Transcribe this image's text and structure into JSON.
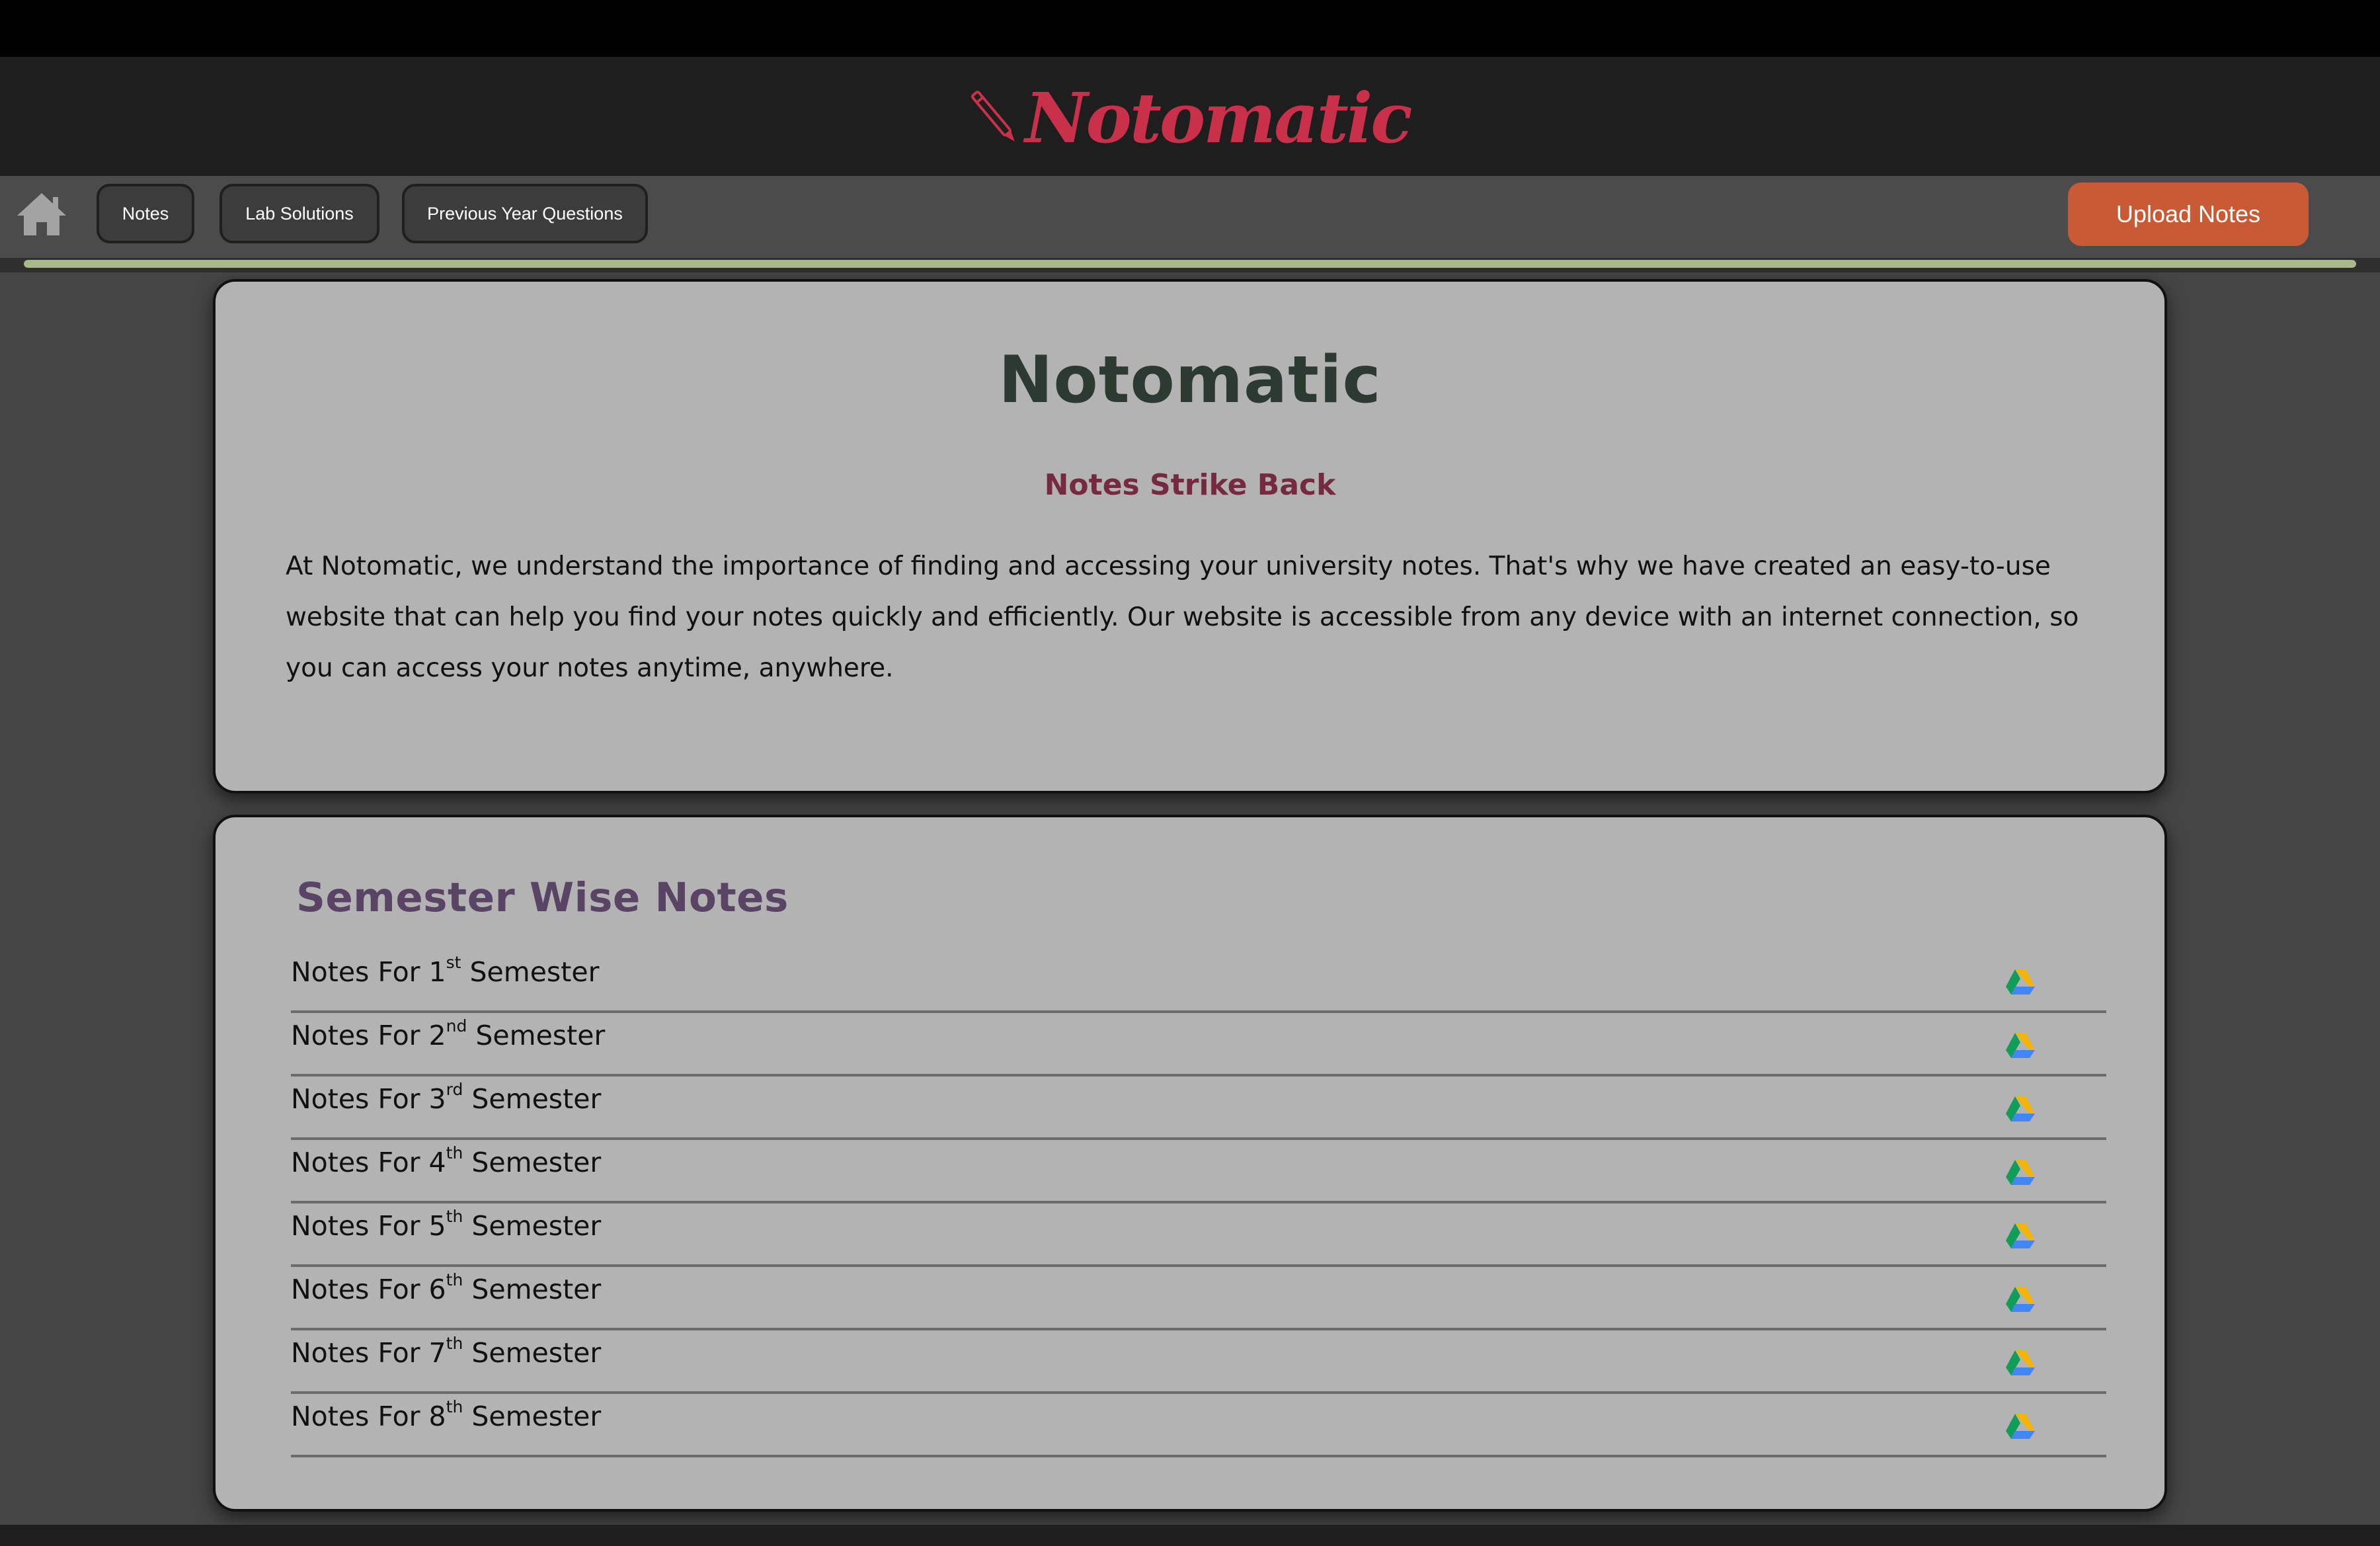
{
  "brand": {
    "logo_text": "Notomatic",
    "logo_color": "#c9314a"
  },
  "nav": {
    "home_icon": "home-icon",
    "items": [
      {
        "label": "Notes"
      },
      {
        "label": "Lab Solutions"
      },
      {
        "label": "Previous Year Questions"
      }
    ],
    "upload_label": "Upload Notes",
    "accent_color": "#c95a36"
  },
  "progress": {
    "fill_percent": 100,
    "color": "#a9b98a"
  },
  "hero": {
    "title": "Notomatic",
    "subtitle": "Notes Strike Back",
    "description": "At Notomatic, we understand the importance of finding and accessing your university notes. That's why we have created an easy-to-use website that can help you find your notes quickly and efficiently. Our website is accessible from any device with an internet connection, so you can access your notes anytime, anywhere."
  },
  "semesters": {
    "title": "Semester Wise Notes",
    "link_icon": "google-drive-icon",
    "items": [
      {
        "prefix": "Notes For ",
        "number": "1",
        "suffix": "st",
        "tail": " Semester"
      },
      {
        "prefix": "Notes For ",
        "number": "2",
        "suffix": "nd",
        "tail": " Semester"
      },
      {
        "prefix": "Notes For ",
        "number": "3",
        "suffix": "rd",
        "tail": " Semester"
      },
      {
        "prefix": "Notes For ",
        "number": "4",
        "suffix": "th",
        "tail": " Semester"
      },
      {
        "prefix": "Notes For ",
        "number": "5",
        "suffix": "th",
        "tail": " Semester"
      },
      {
        "prefix": "Notes For ",
        "number": "6",
        "suffix": "th",
        "tail": " Semester"
      },
      {
        "prefix": "Notes For ",
        "number": "7",
        "suffix": "th",
        "tail": " Semester"
      },
      {
        "prefix": "Notes For ",
        "number": "8",
        "suffix": "th",
        "tail": " Semester"
      }
    ]
  }
}
